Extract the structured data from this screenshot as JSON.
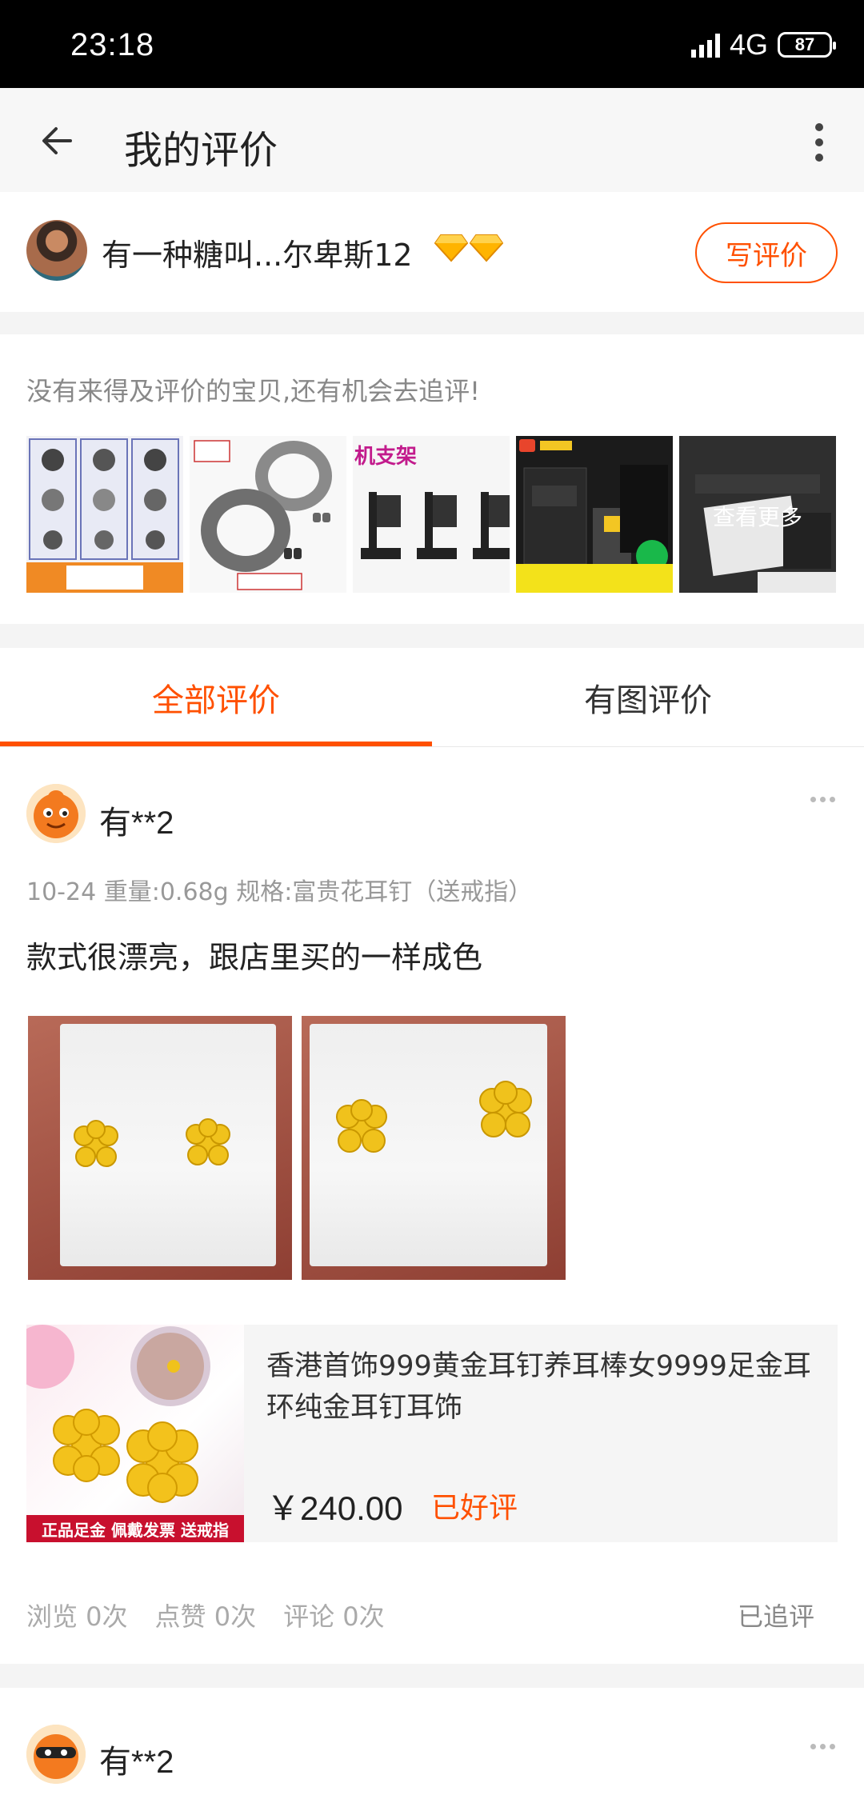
{
  "status_bar": {
    "time": "23:18",
    "network": "4G",
    "battery": "87"
  },
  "header": {
    "title": "我的评价",
    "back_icon": "arrow-left-icon",
    "more_icon": "more-vertical-icon"
  },
  "user": {
    "name": "有一种糖叫...尔卑斯12",
    "level_icon": "diamond-icon",
    "level_count": 2,
    "write_review_label": "写评价"
  },
  "pending": {
    "text": "没有来得及评价的宝贝,还有机会去追评!",
    "thumbnail_count": 5,
    "more_label": "查看更多"
  },
  "tabs": [
    {
      "label": "全部评价",
      "active": true
    },
    {
      "label": "有图评价",
      "active": false
    }
  ],
  "reviews": [
    {
      "user": "有**2",
      "meta": "10-24  重量:0.68g 规格:富贵花耳钉（送戒指）",
      "text": "款式很漂亮，跟店里买的一样成色",
      "photo_count": 2,
      "product": {
        "title": "香港首饰999黄金耳钉养耳棒女9999足金耳环纯金耳钉耳饰",
        "price": "￥240.00",
        "status": "已好评",
        "banner": "正品足金 佩戴发票 送戒指"
      },
      "stats": {
        "views": "浏览 0次",
        "likes": "点赞 0次",
        "comments": "评论 0次"
      },
      "followup": "已追评"
    },
    {
      "user": "有**2"
    }
  ],
  "colors": {
    "accent": "#ff5000",
    "background": "#f4f4f4"
  }
}
